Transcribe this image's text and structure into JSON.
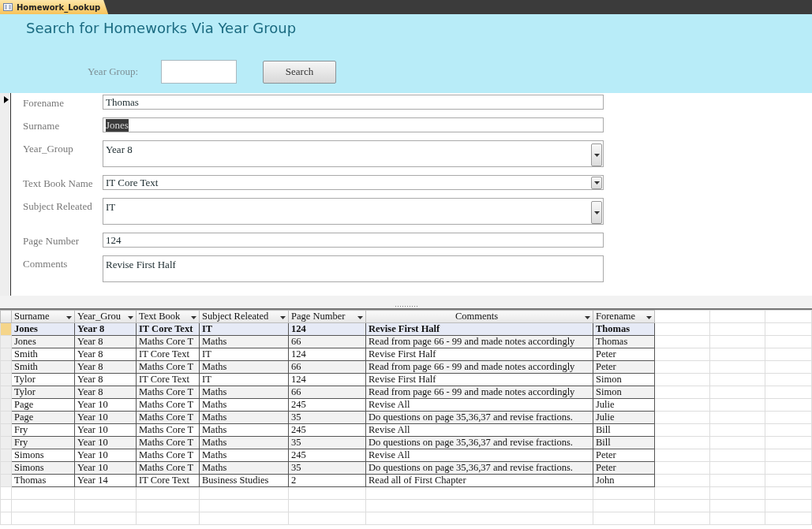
{
  "tab": {
    "label": "Homework_Lookup",
    "selected": true
  },
  "header": {
    "title": "Search for Homeworks Via Year Group",
    "search_label": "Year Group:",
    "search_button": "Search"
  },
  "form": {
    "fields": [
      {
        "label": "Forename",
        "value": "Thomas",
        "kind": "text",
        "text_selected": false
      },
      {
        "label": "Surname",
        "value": "Jones",
        "kind": "text",
        "text_selected": true
      },
      {
        "label": "Year_Group",
        "value": "Year 8",
        "kind": "combo",
        "text_selected": false
      },
      {
        "label": "Text Book Name",
        "value": "IT Core Text",
        "kind": "combo",
        "text_selected": false
      },
      {
        "label": "Subject Releated",
        "value": "IT",
        "kind": "combo",
        "text_selected": false
      },
      {
        "label": "Page Number",
        "value": "124",
        "kind": "text",
        "text_selected": false
      },
      {
        "label": "Comments",
        "value": "Revise First Half",
        "kind": "text",
        "text_selected": false
      }
    ]
  },
  "table": {
    "columns": [
      "Surname",
      "Year_Grou",
      "Text Book",
      "Subject Releated",
      "Page Number",
      "Comments",
      "Forename"
    ],
    "rows": [
      {
        "cells": [
          "Jones",
          "Year 8",
          "IT Core Text",
          "IT",
          "124",
          "Revise First Half",
          "Thomas"
        ],
        "selected": true
      },
      {
        "cells": [
          "Jones",
          "Year 8",
          "Maths Core T",
          "Maths",
          "66",
          "Read from page 66 - 99 and made notes accordingly",
          "Thomas"
        ],
        "selected": false
      },
      {
        "cells": [
          "Smith",
          "Year 8",
          "IT Core Text",
          "IT",
          "124",
          "Revise First Half",
          "Peter"
        ],
        "selected": false
      },
      {
        "cells": [
          "Smith",
          "Year 8",
          "Maths Core T",
          "Maths",
          "66",
          "Read from page 66 - 99 and made notes accordingly",
          "Peter"
        ],
        "selected": false
      },
      {
        "cells": [
          "Tylor",
          "Year 8",
          "IT Core Text",
          "IT",
          "124",
          "Revise First Half",
          "Simon"
        ],
        "selected": false
      },
      {
        "cells": [
          "Tylor",
          "Year 8",
          "Maths Core T",
          "Maths",
          "66",
          "Read from page 66 - 99 and made notes accordingly",
          "Simon"
        ],
        "selected": false
      },
      {
        "cells": [
          "Page",
          "Year 10",
          "Maths Core T",
          "Maths",
          "245",
          "Revise All",
          "Julie"
        ],
        "selected": false
      },
      {
        "cells": [
          "Page",
          "Year 10",
          "Maths Core T",
          "Maths",
          "35",
          "Do questions on page 35,36,37 and revise fractions.",
          "Julie"
        ],
        "selected": false
      },
      {
        "cells": [
          "Fry",
          "Year 10",
          "Maths Core T",
          "Maths",
          "245",
          "Revise All",
          "Bill"
        ],
        "selected": false
      },
      {
        "cells": [
          "Fry",
          "Year 10",
          "Maths Core T",
          "Maths",
          "35",
          "Do questions on page 35,36,37 and revise fractions.",
          "Bill"
        ],
        "selected": false
      },
      {
        "cells": [
          "Simons",
          "Year 10",
          "Maths Core T",
          "Maths",
          "245",
          "Revise All",
          "Peter"
        ],
        "selected": false
      },
      {
        "cells": [
          "Simons",
          "Year 10",
          "Maths Core T",
          "Maths",
          "35",
          "Do questions on page 35,36,37 and revise fractions.",
          "Peter"
        ],
        "selected": false
      },
      {
        "cells": [
          "Thomas",
          "Year 14",
          "IT Core Text",
          "Business Studies",
          "2",
          "Read all of First Chapter",
          "John"
        ],
        "selected": false
      }
    ]
  }
}
